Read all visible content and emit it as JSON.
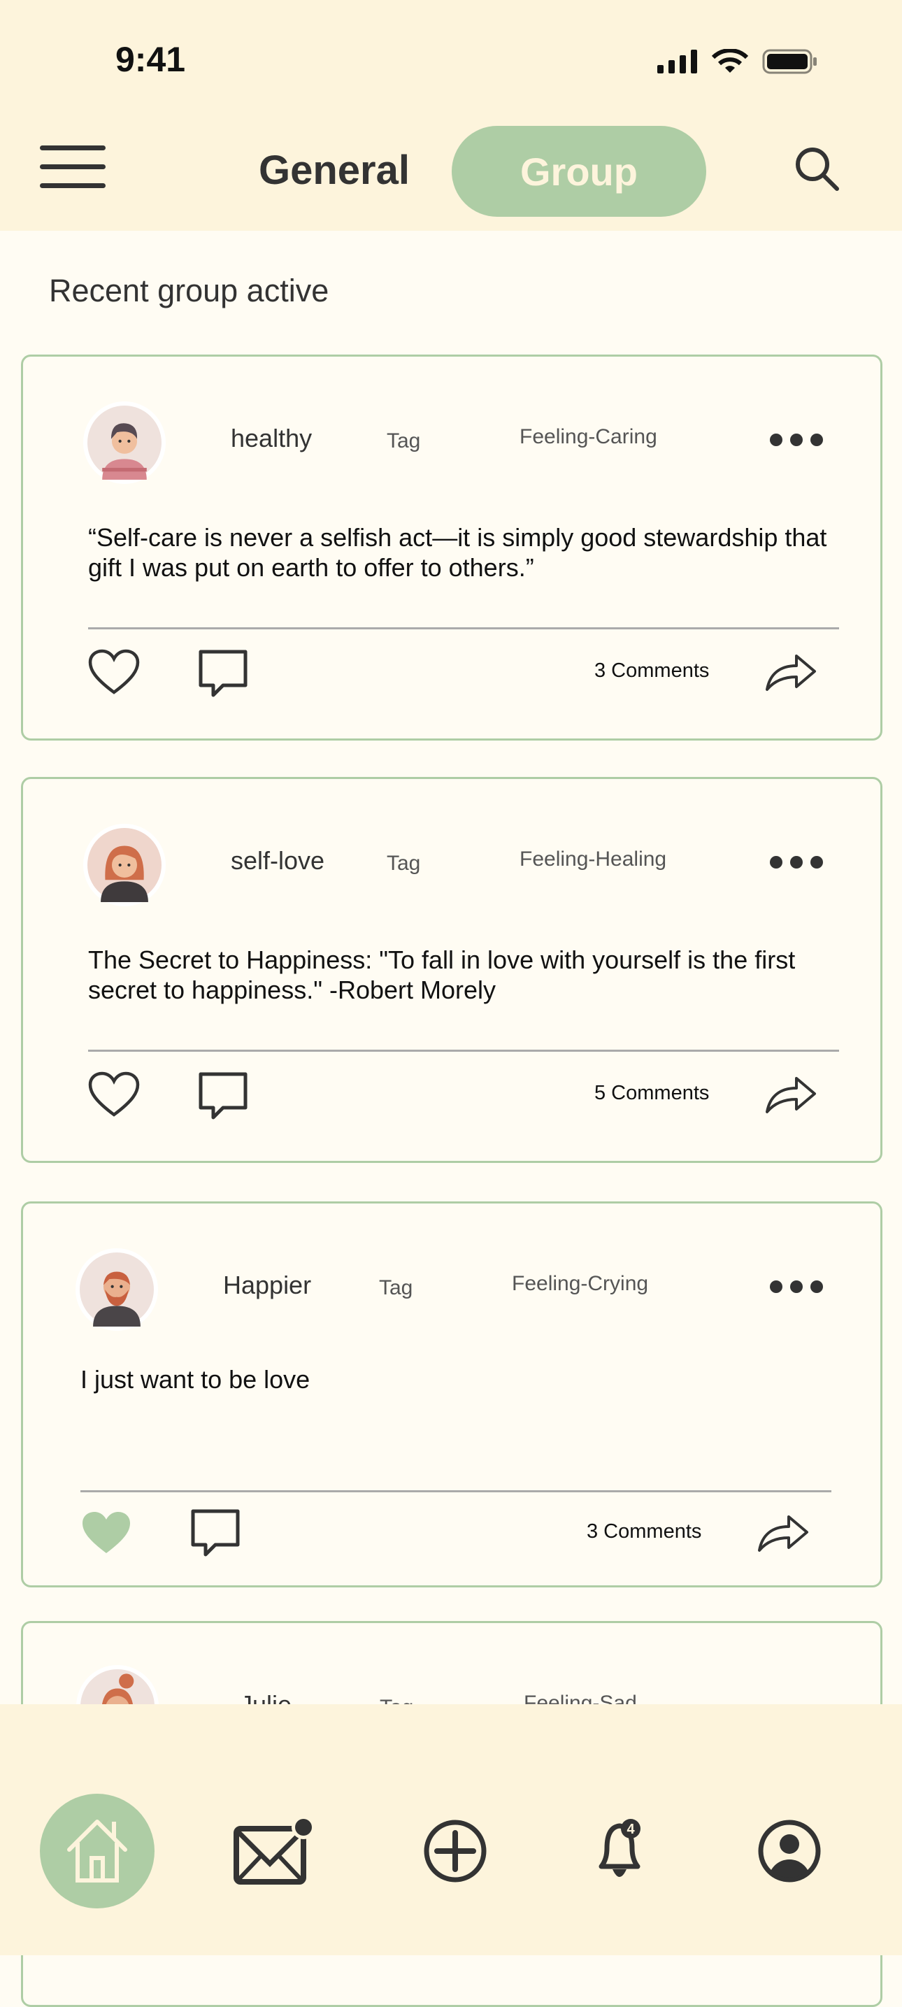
{
  "status_bar": {
    "time": "9:41"
  },
  "header": {
    "tabs": [
      {
        "label": "General"
      },
      {
        "label": "Group",
        "active": true
      }
    ]
  },
  "section_title": "Recent group active",
  "posts": [
    {
      "username": "healthy",
      "tag": "Tag",
      "feeling": "Feeling-Caring",
      "text": "“Self-care is never a selfish act—it is simply good stewardship that gift I was put on earth to offer to others.”",
      "comments": "3 Comments",
      "liked": false
    },
    {
      "username": "self-love",
      "tag": "Tag",
      "feeling": "Feeling-Healing",
      "text": "The Secret to Happiness: \"To fall in love with yourself is the first secret to happiness.\" -Robert Morely",
      "comments": "5 Comments",
      "liked": false
    },
    {
      "username": "Happier",
      "tag": "Tag",
      "feeling": "Feeling-Crying",
      "text": "I just want to be love",
      "comments": "3 Comments",
      "liked": true
    },
    {
      "username": "Julie",
      "tag": "Tag",
      "feeling": "Feeling-Sad"
    }
  ],
  "nav": {
    "notification_count": "4",
    "items": [
      "home",
      "messages",
      "create",
      "notifications",
      "profile"
    ]
  },
  "colors": {
    "accent": "#aecda5",
    "header_bg": "#fdf4dc",
    "page_bg": "#fffcf3",
    "icon": "#333333"
  }
}
